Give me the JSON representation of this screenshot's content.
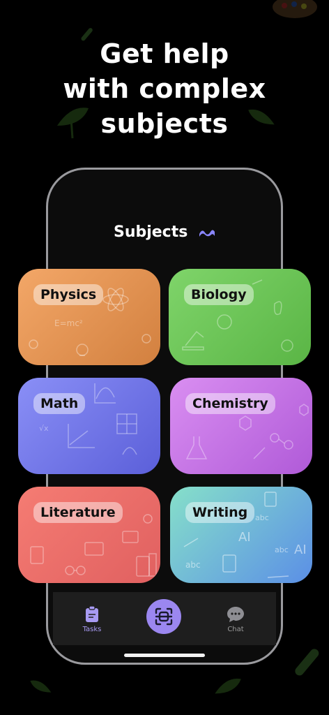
{
  "headline": {
    "line1": "Get help",
    "line2": "with complex",
    "line3": "subjects"
  },
  "screen": {
    "title": "Subjects"
  },
  "subjects": [
    {
      "label": "Physics"
    },
    {
      "label": "Biology"
    },
    {
      "label": "Math"
    },
    {
      "label": "Chemistry"
    },
    {
      "label": "Literature"
    },
    {
      "label": "Writing"
    }
  ],
  "tabs": [
    {
      "label": "Tasks",
      "icon": "clipboard-icon",
      "active": true
    },
    {
      "label": "",
      "icon": "scan-icon"
    },
    {
      "label": "Chat",
      "icon": "chat-bubble-icon"
    }
  ],
  "colors": {
    "accent": "#9b87f0",
    "background": "#000000"
  }
}
